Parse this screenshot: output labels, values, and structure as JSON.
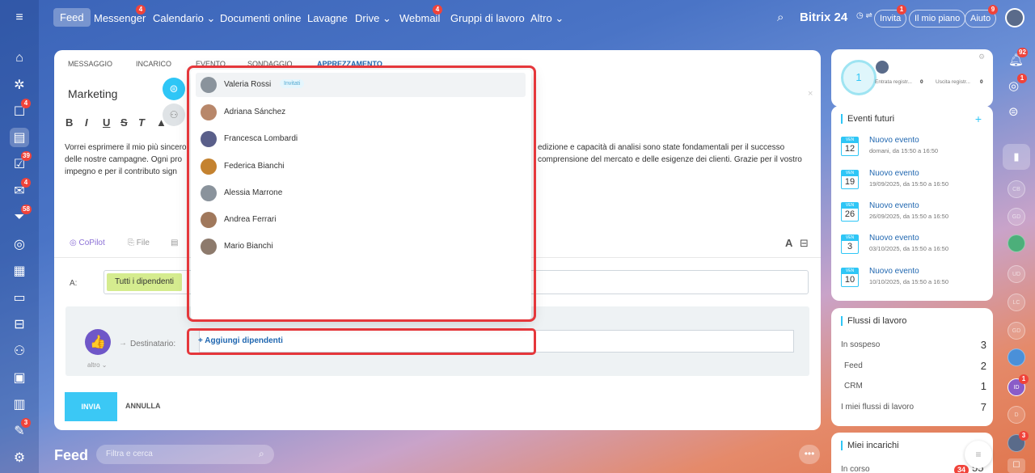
{
  "topbar": {
    "nav": [
      {
        "label": "Feed",
        "badge": ""
      },
      {
        "label": "Messenger",
        "badge": "4"
      },
      {
        "label": "Calendario",
        "badge": ""
      },
      {
        "label": "Documenti online",
        "badge": ""
      },
      {
        "label": "Lavagne",
        "badge": ""
      },
      {
        "label": "Drive",
        "badge": ""
      },
      {
        "label": "Webmail",
        "badge": "4"
      },
      {
        "label": "Gruppi di lavoro",
        "badge": ""
      },
      {
        "label": "Altro",
        "badge": ""
      }
    ],
    "brand": "Bitrix 24",
    "invite_label": "Invita",
    "invite_badge": "1",
    "plan_label": "Il mio piano",
    "help_label": "Aiuto",
    "help_badge": "9"
  },
  "leftbar_badges": {
    "chat": "4",
    "tasks": "39",
    "mail": "4",
    "crm": "58",
    "bp": "3"
  },
  "composer": {
    "tabs": [
      "Messaggio",
      "Incarico",
      "Evento",
      "Sondaggio",
      "Apprezzamento"
    ],
    "title": "Marketing",
    "body_line1": "Vorrei esprimere il mio più sincero",
    "body_line1b": "edizione e capacità di analisi sono state fondamentali per il successo",
    "body_line2": "delle nostre campagne. Ogni pro",
    "body_line2b": "comprensione del mercato e delle esigenze dei clienti. Grazie per il vostro",
    "body_line3": "impegno e per il contributo sign",
    "copilot": "CoPilot",
    "file": "File",
    "to_label": "A:",
    "to_chip": "Tutti i dipendenti",
    "dest_label": "Destinatario:",
    "altro": "altro",
    "send": "INVIA",
    "cancel": "ANNULLA"
  },
  "dropdown": {
    "users": [
      {
        "name": "Valeria Rossi",
        "invited": "Invitati",
        "avatar": "generic"
      },
      {
        "name": "Adriana Sánchez",
        "invited": "",
        "avatar": "photo"
      },
      {
        "name": "Francesca Lombardi",
        "invited": "",
        "avatar": "photo"
      },
      {
        "name": "Federica Bianchi",
        "invited": "",
        "avatar": "photo"
      },
      {
        "name": "Alessia Marrone",
        "invited": "",
        "avatar": "generic"
      },
      {
        "name": "Andrea Ferrari",
        "invited": "",
        "avatar": "photo"
      },
      {
        "name": "Mario Bianchi",
        "invited": "",
        "avatar": "photo"
      }
    ],
    "add_label": "+ Aggiungi dipendenti"
  },
  "worktime": {
    "count": "1",
    "in_label": "Entrata registr...",
    "in_val": "0",
    "out_label": "Uscita registr...",
    "out_val": "0"
  },
  "events": {
    "title": "Eventi futuri",
    "items": [
      {
        "day": "VEN",
        "num": "12",
        "title": "Nuovo evento",
        "sub": "domani, da 15:50 a 16:50"
      },
      {
        "day": "VEN",
        "num": "19",
        "title": "Nuovo evento",
        "sub": "19/09/2025, da 15:50 a 16:50"
      },
      {
        "day": "VEN",
        "num": "26",
        "title": "Nuovo evento",
        "sub": "26/09/2025, da 15:50 a 16:50"
      },
      {
        "day": "VEN",
        "num": "3",
        "title": "Nuovo evento",
        "sub": "03/10/2025, da 15:50 a 16:50"
      },
      {
        "day": "VEN",
        "num": "10",
        "title": "Nuovo evento",
        "sub": "10/10/2025, da 15:50 a 16:50"
      }
    ]
  },
  "workflows": {
    "title": "Flussi di lavoro",
    "rows": [
      {
        "label": "In sospeso",
        "num": "3"
      },
      {
        "label": "Feed",
        "num": "2"
      },
      {
        "label": "CRM",
        "num": "1"
      },
      {
        "label": "I miei flussi di lavoro",
        "num": "7"
      }
    ]
  },
  "tasks": {
    "title": "Miei incarichi",
    "row": "In corso",
    "badge": "34",
    "num": "55"
  },
  "rightrail": {
    "notif_badge": "92",
    "second_badge": "1",
    "avatars": [
      "CB",
      "GD",
      "UD",
      "LC",
      "GD",
      "ID",
      "D"
    ],
    "id_badge": "1",
    "bottom_badge": "3"
  },
  "feed": {
    "title": "Feed",
    "search_placeholder": "Filtra e cerca"
  }
}
